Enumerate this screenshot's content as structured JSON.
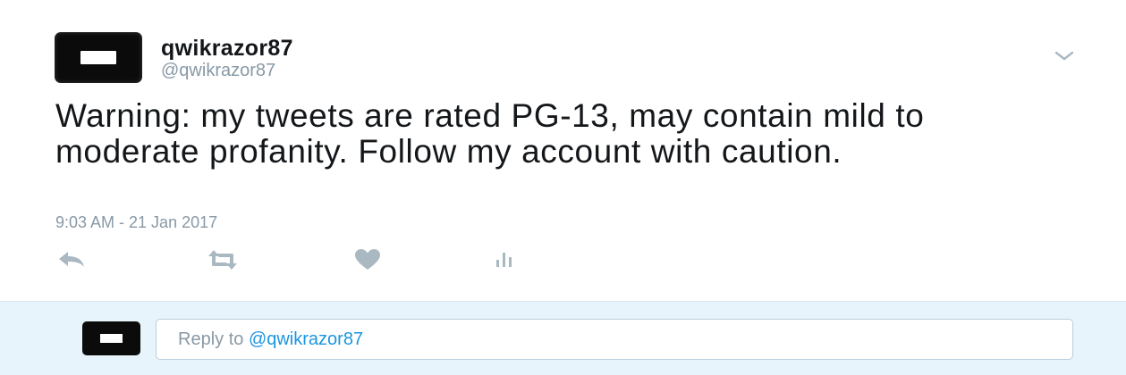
{
  "tweet": {
    "display_name": "qwikrazor87",
    "handle": "@qwikrazor87",
    "text": "Warning: my tweets are rated PG-13, may contain mild to moderate profanity. Follow my account with caution.",
    "timestamp": "9:03 AM - 21 Jan 2017",
    "actions": {
      "reply_icon": "reply-icon",
      "retweet_icon": "retweet-icon",
      "like_icon": "heart-icon",
      "analytics_icon": "analytics-icon"
    },
    "menu_icon": "chevron-down-icon"
  },
  "reply": {
    "prefix": "Reply to ",
    "mention": "@qwikrazor87"
  },
  "colors": {
    "text": "#14171a",
    "muted": "#8899a6",
    "icon": "#aab8c2",
    "link": "#1b95e0",
    "reply_bar": "#e8f4fb"
  }
}
